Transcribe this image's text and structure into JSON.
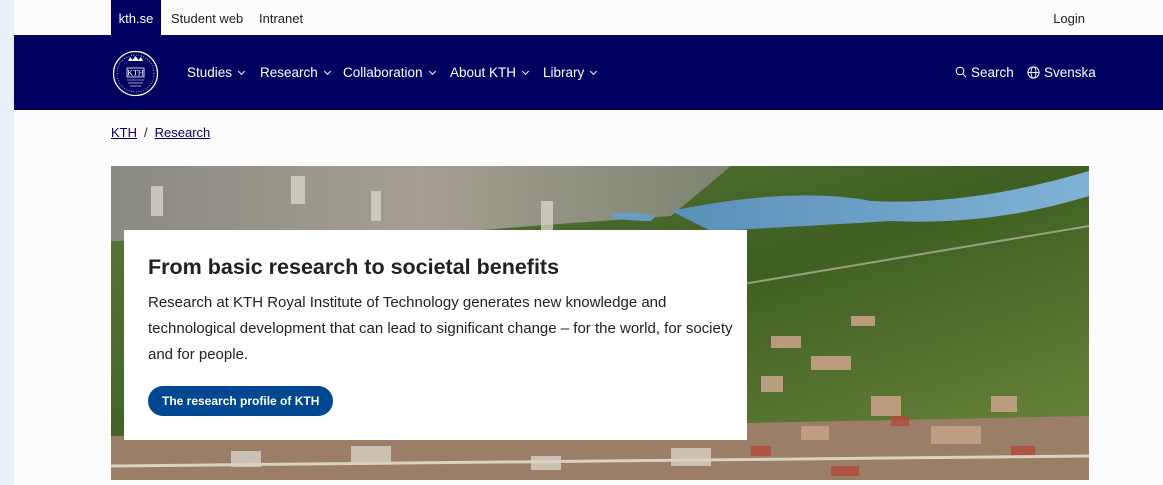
{
  "topbar": {
    "brand_label": "kth.se",
    "student_web_label": "Student web",
    "intranet_label": "Intranet",
    "login_label": "Login"
  },
  "nav": {
    "items": [
      {
        "label": "Studies"
      },
      {
        "label": "Research"
      },
      {
        "label": "Collaboration"
      },
      {
        "label": "About KTH"
      },
      {
        "label": "Library"
      }
    ],
    "search_label": "Search",
    "language_label": "Svenska"
  },
  "breadcrumb": {
    "home": "KTH",
    "separator": "/",
    "current": "Research"
  },
  "hero": {
    "title": "From basic research to societal benefits",
    "text": "Research at KTH Royal Institute of Technology generates new knowledge and technological development that can lead to significant change – for the world, for society and for people.",
    "button_label": "The research profile of KTH"
  },
  "colors": {
    "navy": "#000061",
    "button": "#004791",
    "side_background": "#e8f1fa"
  },
  "icons": {
    "logo": "kth-crest-logo",
    "search": "search-icon",
    "language": "globe-icon",
    "chevron": "chevron-down-icon"
  }
}
